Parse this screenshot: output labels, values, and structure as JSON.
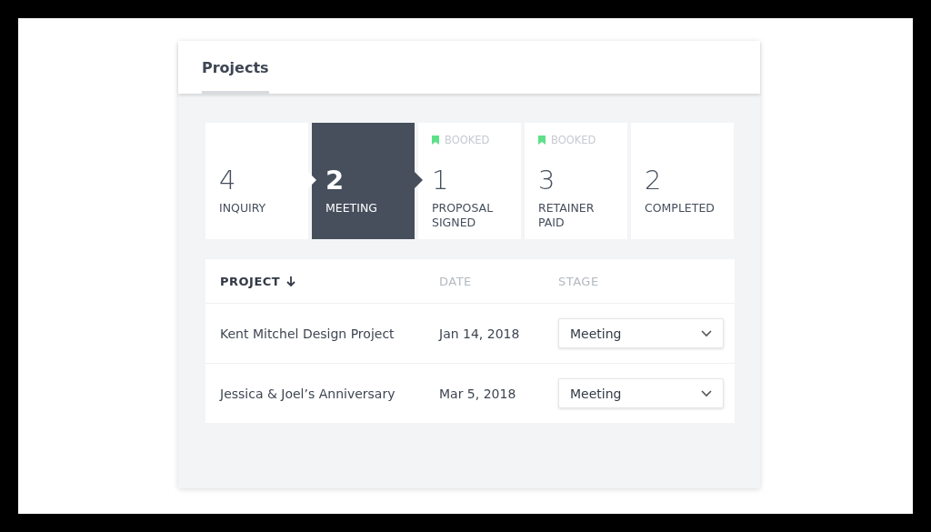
{
  "header": {
    "tabs": [
      {
        "label": "Projects",
        "selected": true
      }
    ]
  },
  "stages": [
    {
      "count": "4",
      "label": "INQUIRY",
      "selected": false
    },
    {
      "count": "2",
      "label": "MEETING",
      "selected": true
    },
    {
      "count": "1",
      "label": "PROPOSAL SIGNED",
      "selected": false,
      "tag": "BOOKED"
    },
    {
      "count": "3",
      "label": "RETAINER PAID",
      "selected": false,
      "tag": "BOOKED"
    },
    {
      "count": "2",
      "label": "COMPLETED",
      "selected": false
    }
  ],
  "table": {
    "columns": [
      {
        "label": "PROJECT",
        "sorted": true
      },
      {
        "label": "DATE",
        "sorted": false
      },
      {
        "label": "STAGE",
        "sorted": false
      }
    ],
    "rows": [
      {
        "project": "Kent Mitchel Design Project",
        "date": "Jan 14, 2018",
        "stage": "Meeting"
      },
      {
        "project": "Jessica & Joel’s Anniversary",
        "date": "Mar 5, 2018",
        "stage": "Meeting"
      }
    ]
  }
}
